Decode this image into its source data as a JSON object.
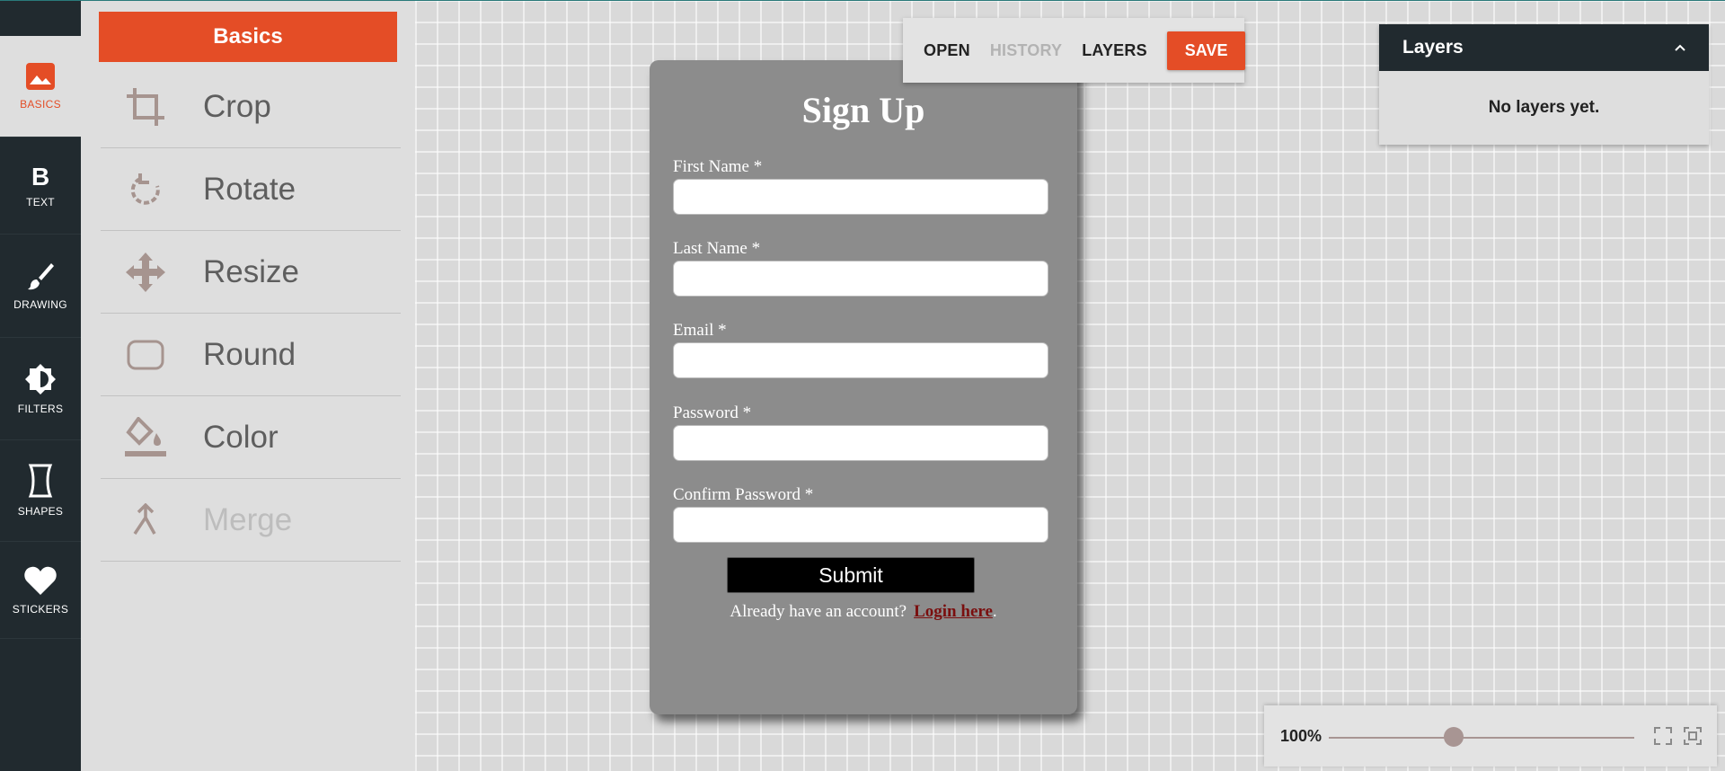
{
  "nav": {
    "items": [
      {
        "label": "BASICS",
        "icon": "image-icon"
      },
      {
        "label": "TEXT",
        "icon": "bold-icon"
      },
      {
        "label": "DRAWING",
        "icon": "brush-icon"
      },
      {
        "label": "FILTERS",
        "icon": "brightness-icon"
      },
      {
        "label": "SHAPES",
        "icon": "shape-icon"
      },
      {
        "label": "STICKERS",
        "icon": "heart-icon"
      }
    ],
    "active": "BASICS",
    "active_color": "#e44d26"
  },
  "panel": {
    "title": "Basics",
    "tools": [
      {
        "label": "Crop",
        "icon": "crop-icon",
        "enabled": true
      },
      {
        "label": "Rotate",
        "icon": "rotate-icon",
        "enabled": true
      },
      {
        "label": "Resize",
        "icon": "resize-icon",
        "enabled": true
      },
      {
        "label": "Round",
        "icon": "round-corners-icon",
        "enabled": true
      },
      {
        "label": "Color",
        "icon": "paint-bucket-icon",
        "enabled": true
      },
      {
        "label": "Merge",
        "icon": "merge-icon",
        "enabled": false
      }
    ]
  },
  "toolbar": {
    "open": "OPEN",
    "history": "HISTORY",
    "layers": "LAYERS",
    "save": "SAVE"
  },
  "form": {
    "title": "Sign Up",
    "fields": [
      {
        "label": "First Name *",
        "value": ""
      },
      {
        "label": "Last Name *",
        "value": ""
      },
      {
        "label": "Email *",
        "value": ""
      },
      {
        "label": "Password *",
        "value": ""
      },
      {
        "label": "Confirm Password *",
        "value": ""
      }
    ],
    "submit": "Submit",
    "login_prompt": "Already have an account?",
    "login_link": "Login here",
    "login_suffix": "."
  },
  "layers_panel": {
    "title": "Layers",
    "empty_text": "No layers yet."
  },
  "zoom": {
    "value": "100%",
    "level": 0.41
  },
  "colors": {
    "accent": "#e44d26",
    "dark": "#212a2f",
    "card": "#8c8c8c"
  }
}
